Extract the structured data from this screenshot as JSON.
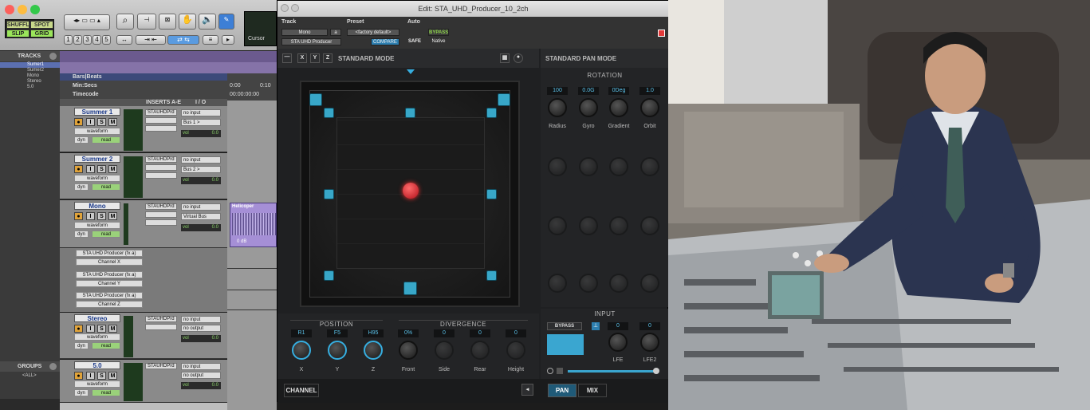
{
  "toolbar": {
    "modes": [
      "SHUFFLE",
      "SPOT",
      "SLIP",
      "GRID"
    ],
    "zoom_presets": [
      "1",
      "2",
      "3",
      "4",
      "5"
    ],
    "cursor_label": "Cursor"
  },
  "tracks_pane": {
    "title": "TRACKS",
    "items": [
      "Sumer1",
      "Sumer2",
      "Mono",
      "Stereo",
      "5.0"
    ]
  },
  "groups_pane": {
    "title": "GROUPS",
    "items": [
      "<ALL>"
    ]
  },
  "rulers": {
    "bars_beats": "Bars|Beats",
    "min_secs": "Min:Secs",
    "timecode": "Timecode",
    "t0": "0:00",
    "t1": "0:10",
    "tc0": "00:00:00:00"
  },
  "columns": {
    "inserts": "INSERTS A-E",
    "io": "I / O"
  },
  "tracks": [
    {
      "name": "Summer 1",
      "view": "waveform",
      "dyn": "dyn",
      "auto": "read",
      "insert": "STAUHDPrd",
      "input": "no input",
      "output": "Bus 1 >",
      "vol_label": "vol",
      "vol": "0.0"
    },
    {
      "name": "Summer 2",
      "view": "waveform",
      "dyn": "dyn",
      "auto": "read",
      "insert": "STAUHDPrd",
      "input": "no input",
      "output": "Bus 2 >",
      "vol_label": "vol",
      "vol": "0.0"
    },
    {
      "name": "Mono",
      "view": "waveform",
      "dyn": "dyn",
      "auto": "read",
      "insert": "STAUHDPrd",
      "input": "no input",
      "output": "Virtual Bus",
      "vol_label": "vol",
      "vol": "0.0"
    },
    {
      "name": "Stereo",
      "view": "waveform",
      "dyn": "dyn",
      "auto": "read",
      "insert": "STAUHDPrd",
      "input": "no input",
      "output": "no output",
      "vol_label": "vol",
      "vol": "0.0"
    },
    {
      "name": "5.0",
      "view": "waveform",
      "dyn": "dyn",
      "auto": "read",
      "insert": "STAUHDPrd",
      "input": "no input",
      "output": "no output",
      "vol_label": "vol",
      "vol": "0.0"
    }
  ],
  "track_buttons": {
    "solo": "S",
    "mute": "M",
    "input": "I"
  },
  "automation_lanes": [
    {
      "plugin": "STA UHD Producer (fx a)",
      "param": "Channel X"
    },
    {
      "plugin": "STA UHD Producer (fx a)",
      "param": "Channel Y"
    },
    {
      "plugin": "STA UHD Producer (fx a)",
      "param": "Channel Z"
    }
  ],
  "clip": {
    "name": "Helicoper",
    "gain": "0 dB"
  },
  "plugin": {
    "window_title": "Edit: STA_UHD_Producer_10_2ch",
    "track_label": "Track",
    "track_name": "Mono",
    "track_suffix": "a",
    "insert_name": "STA UHD Producer",
    "preset_label": "Preset",
    "preset_value": "<factory default>",
    "compare": "COMPARE",
    "auto_label": "Auto",
    "safe": "SAFE",
    "bypass": "BYPASS",
    "native": "Native",
    "axis_buttons": [
      "X",
      "Y",
      "Z"
    ],
    "mode_left": "STANDARD MODE",
    "mode_right": "STANDARD PAN MODE",
    "rotation": {
      "title": "ROTATION",
      "values": [
        "100",
        "0.0G",
        "0Deg",
        "1.0"
      ],
      "labels": [
        "Radius",
        "Gyro",
        "Gradient",
        "Orbit"
      ]
    },
    "position": {
      "title": "POSITION",
      "values": [
        "R1",
        "F5",
        "H95"
      ],
      "labels": [
        "X",
        "Y",
        "Z"
      ]
    },
    "divergence": {
      "title": "DIVERGENCE",
      "values": [
        "0%",
        "0",
        "0",
        "0"
      ],
      "labels": [
        "Front",
        "Side",
        "Rear",
        "Height"
      ]
    },
    "input": {
      "title": "INPUT",
      "bypass": "BYPASS",
      "values": [
        "0",
        "0"
      ],
      "labels": [
        "LFE",
        "LFE2"
      ]
    },
    "channel_btn": "CHANNEL",
    "tabs": [
      "PAN",
      "MIX"
    ]
  },
  "colors": {
    "accent": "#36aee0",
    "speaker": "#38a7c8",
    "source": "#e0202a",
    "meter": "#8bd36a"
  }
}
